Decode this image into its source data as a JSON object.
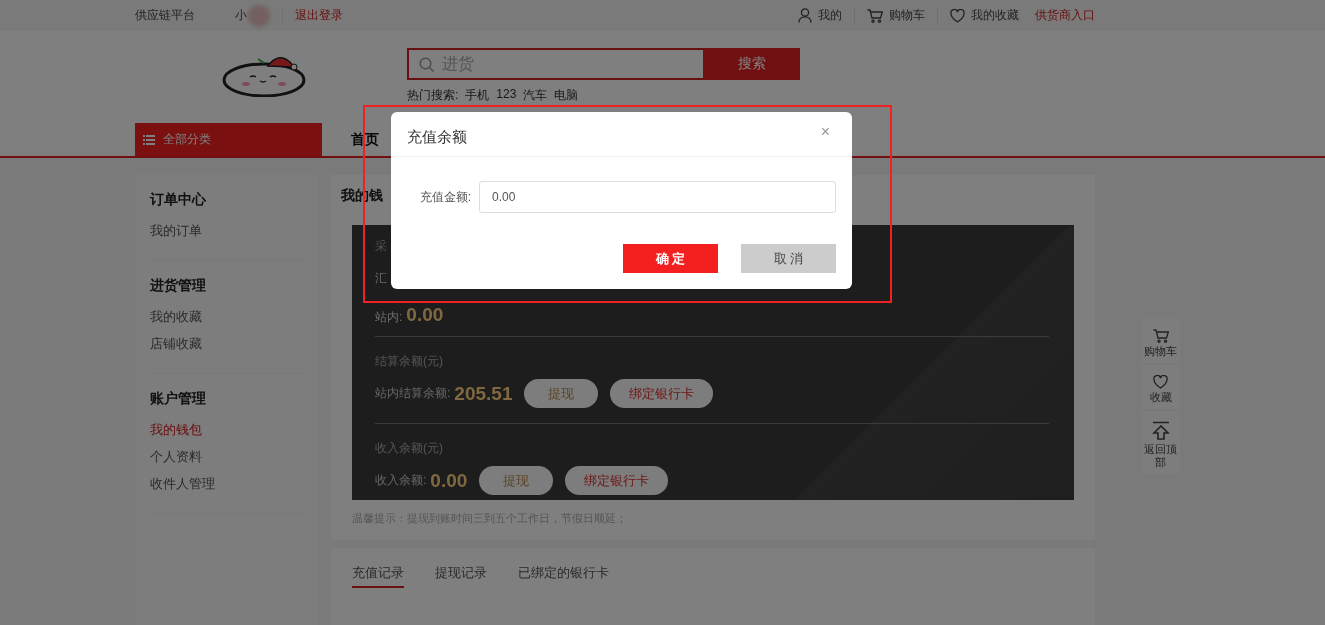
{
  "top_bar": {
    "site": "供应链平台",
    "username": "小",
    "logout": "退出登录",
    "links": [
      {
        "kind": "user",
        "label": "我的"
      },
      {
        "kind": "cart",
        "label": "购物车"
      },
      {
        "kind": "heart",
        "label": "我的收藏"
      }
    ],
    "supplier_entry": "供货商入口"
  },
  "search": {
    "placeholder": "进货",
    "button": "搜索",
    "hot_label": "热门搜索:",
    "hot_terms": [
      "手机",
      "123",
      "汽车",
      "电脑"
    ]
  },
  "nav": {
    "category": "全部分类",
    "items": [
      "首页"
    ]
  },
  "sidebar": {
    "groups": [
      {
        "title": "订单中心",
        "items": [
          {
            "label": "我的订单",
            "selected": false
          }
        ]
      },
      {
        "title": "进货管理",
        "items": [
          {
            "label": "我的收藏",
            "selected": false
          },
          {
            "label": "店铺收藏",
            "selected": false
          }
        ]
      },
      {
        "title": "账户管理",
        "items": [
          {
            "label": "我的钱包",
            "selected": true
          },
          {
            "label": "个人资料",
            "selected": false
          },
          {
            "label": "收件人管理",
            "selected": false
          }
        ]
      }
    ]
  },
  "wallet": {
    "title": "我的钱",
    "purchase": {
      "heading": "采",
      "row_label": "汇",
      "balance_label": "站内:",
      "amount": "0.00"
    },
    "sections": [
      {
        "heading": "结算余额(元)",
        "label": "站内结算余额:",
        "amount": "205.51",
        "buttons": [
          {
            "kind": "withdraw",
            "label": "提现"
          },
          {
            "kind": "bind",
            "label": "绑定银行卡"
          }
        ]
      },
      {
        "heading": "收入余额(元)",
        "label": "收入余额:",
        "amount": "0.00",
        "buttons": [
          {
            "kind": "withdraw",
            "label": "提现"
          },
          {
            "kind": "bind",
            "label": "绑定银行卡"
          }
        ]
      }
    ],
    "tip": "温馨提示：提现到账时间三到五个工作日，节假日顺延；"
  },
  "record_tabs": [
    {
      "label": "充值记录",
      "selected": true
    },
    {
      "label": "提现记录",
      "selected": false
    },
    {
      "label": "已绑定的银行卡",
      "selected": false
    }
  ],
  "side_toolbar": [
    {
      "kind": "cart",
      "label": "购物车"
    },
    {
      "kind": "heart",
      "label": "收藏"
    },
    {
      "kind": "top",
      "label": "返回顶部"
    }
  ],
  "dialog": {
    "title": "充值余额",
    "close": "×",
    "field_label": "充值金额:",
    "field_value": "0.00",
    "confirm": "确 定",
    "cancel": "取 消"
  }
}
